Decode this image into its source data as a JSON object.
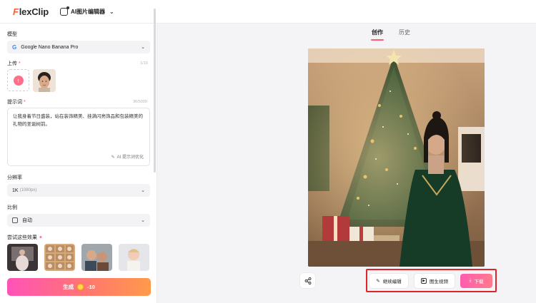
{
  "header": {
    "logo_f": "F",
    "logo_rest": "lexClip",
    "tool_name": "AI图片编辑器"
  },
  "left_panel": {
    "model": {
      "label": "模型",
      "value": "Google Nano Banana Pro",
      "icon": "google-g-icon"
    },
    "upload": {
      "label": "上传",
      "required_mark": "*",
      "count": "1/10"
    },
    "prompt": {
      "label": "提示词",
      "required_mark": "*",
      "count": "36/5000",
      "text": "让我身着节日盛装，站在装饰精美、挂满闪亮饰品和包装精美的礼物的圣诞树前。",
      "optimize_label": "AI 提示词优化"
    },
    "resolution": {
      "label": "分辨率",
      "value": "1K",
      "sub": "(1080px)"
    },
    "ratio": {
      "label": "比例",
      "value": "自动"
    },
    "effects": {
      "label": "尝试这些效果"
    },
    "generate": {
      "label": "生成",
      "cost": "-10"
    }
  },
  "right_panel": {
    "tabs": [
      {
        "label": "创作",
        "active": true
      },
      {
        "label": "历史",
        "active": false
      }
    ],
    "actions": {
      "continue_edit": "继续编辑",
      "image_to_video": "图生视频",
      "download": "下载"
    }
  },
  "colors": {
    "accent": "#ff5a7a",
    "highlight_outline": "#e0242b",
    "generate_gradient_start": "#ff52b8",
    "generate_gradient_end": "#ff9a4b"
  }
}
